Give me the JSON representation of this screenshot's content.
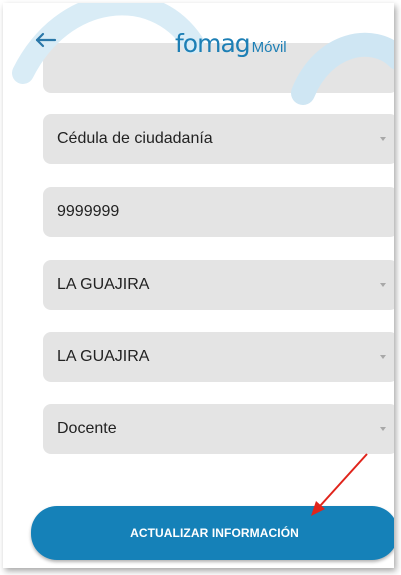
{
  "header": {
    "logo_main": "fomag",
    "logo_sub": "Móvil",
    "back_icon": "arrow-left-icon"
  },
  "form": {
    "document_type": "Cédula de ciudadanía",
    "document_number": "9999999",
    "department": "LA GUAJIRA",
    "municipality": "LA GUAJIRA",
    "user_type": "Docente"
  },
  "actions": {
    "update_label": "ACTUALIZAR INFORMACIÓN"
  },
  "colors": {
    "brand_blue": "#1581b8",
    "field_bg": "#e4e4e4",
    "annotation_arrow": "#e0241b"
  }
}
